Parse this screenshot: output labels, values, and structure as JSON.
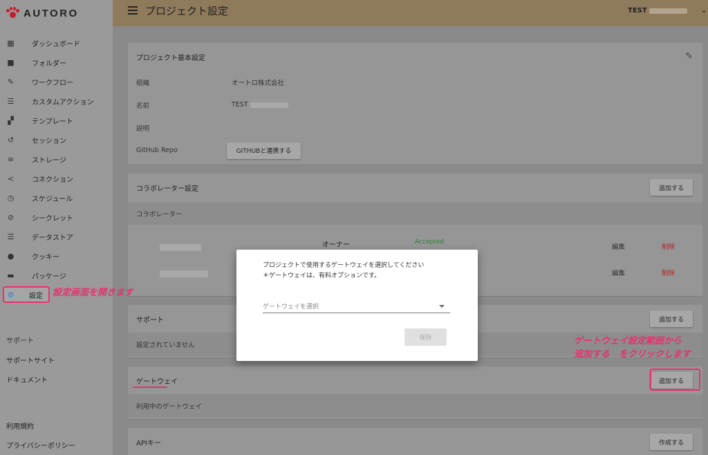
{
  "app": {
    "logo_text": "AUTORO",
    "brand_color": "#c41d2a",
    "accent_color": "#e6326e"
  },
  "sidebar": {
    "items": [
      {
        "label": "ダッシュボード",
        "icon": "dashboard-icon"
      },
      {
        "label": "フォルダー",
        "icon": "folder-icon"
      },
      {
        "label": "ワークフロー",
        "icon": "wrench-icon"
      },
      {
        "label": "カスタムアクション",
        "icon": "list-icon"
      },
      {
        "label": "テンプレート",
        "icon": "template-icon"
      },
      {
        "label": "セッション",
        "icon": "history-icon"
      },
      {
        "label": "ストレージ",
        "icon": "storage-icon"
      },
      {
        "label": "コネクション",
        "icon": "share-icon"
      },
      {
        "label": "スケジュール",
        "icon": "clock-icon"
      },
      {
        "label": "シークレット",
        "icon": "eye-off-icon"
      },
      {
        "label": "データストア",
        "icon": "list-icon"
      },
      {
        "label": "クッキー",
        "icon": "cookie-icon"
      },
      {
        "label": "パッケージ",
        "icon": "package-icon"
      },
      {
        "label": "設定",
        "icon": "gear-icon"
      }
    ],
    "support_heading": "サポート",
    "support_site": "サポートサイト",
    "documents": "ドキュメント",
    "terms": "利用規約",
    "privacy": "プライバシーポリシー"
  },
  "topbar": {
    "title": "プロジェクト設定",
    "user": "TEST"
  },
  "basic": {
    "title": "プロジェクト基本設定",
    "org_label": "組織",
    "org_value": "オートロ株式会社",
    "name_label": "名前",
    "name_value": "TEST",
    "desc_label": "説明",
    "github_label": "GitHub Repo",
    "github_button": "GITHUBと連携する"
  },
  "collab": {
    "title": "コラボレーター設定",
    "add": "追加する",
    "sub": "コラボレーター",
    "role": "オーナー",
    "status": "Accepted",
    "edit": "編集",
    "delete": "削除"
  },
  "support": {
    "title": "サポート",
    "add": "追加する",
    "empty": "設定されていません"
  },
  "gateway": {
    "title": "ゲートウェイ",
    "add": "追加する",
    "sub": "利用中のゲートウェイ"
  },
  "api": {
    "title": "APIキー",
    "create": "作成する"
  },
  "modal": {
    "line1": "プロジェクトで使用するゲートウェイを選択してください",
    "line2": "＊ゲートウェイは、有料オプションです。",
    "select_placeholder": "ゲートウェイを選択",
    "save": "保存"
  },
  "annotations": {
    "settings_note": "設定画面を開きます",
    "gateway_note_1": "ゲートウェイ設定範囲から",
    "gateway_note_2": "追加する　をクリックします"
  }
}
